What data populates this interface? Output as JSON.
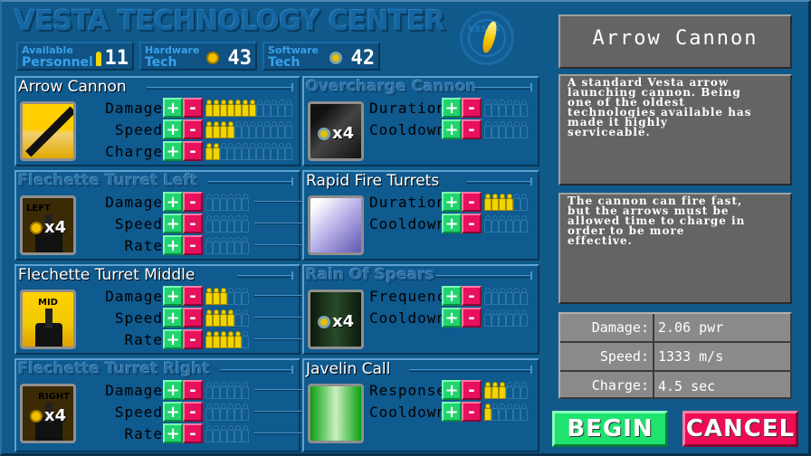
{
  "header": {
    "title": "VESTA TECHNOLOGY CENTER",
    "logo_text": "VESTA",
    "resources": [
      {
        "line1": "Available",
        "line2": "Personnel",
        "icon": "personnel-icon",
        "value": "11"
      },
      {
        "line1": "Hardware",
        "line2": "Tech",
        "icon": "hardware-tech-icon",
        "value": "43"
      },
      {
        "line1": "Software",
        "line2": "Tech",
        "icon": "software-tech-icon",
        "value": "42"
      }
    ]
  },
  "technologies": [
    {
      "name": "Arrow Cannon",
      "locked": false,
      "thumb_label": "",
      "cost": "",
      "stats": [
        {
          "label": "Damage",
          "level": 7,
          "max": 12
        },
        {
          "label": "Speed",
          "level": 4,
          "max": 12
        },
        {
          "label": "Charge",
          "level": 2,
          "max": 12
        }
      ]
    },
    {
      "name": "Overcharge Cannon",
      "locked": true,
      "thumb_label": "",
      "cost": "x4",
      "cost_type": "software",
      "stats": [
        {
          "label": "Duration",
          "level": 0,
          "max": 6
        },
        {
          "label": "Cooldown",
          "level": 0,
          "max": 6
        }
      ]
    },
    {
      "name": "Flechette Turret Left",
      "locked": true,
      "thumb_label": "LEFT",
      "cost": "x4",
      "cost_type": "hardware",
      "stats": [
        {
          "label": "Damage",
          "level": 0,
          "max": 6
        },
        {
          "label": "Speed",
          "level": 0,
          "max": 6
        },
        {
          "label": "Rate",
          "level": 0,
          "max": 6
        }
      ]
    },
    {
      "name": "Rapid Fire Turrets",
      "locked": false,
      "thumb_label": "",
      "cost": "",
      "stats": [
        {
          "label": "Duration",
          "level": 4,
          "max": 6
        },
        {
          "label": "Cooldown",
          "level": 0,
          "max": 6
        }
      ]
    },
    {
      "name": "Flechette Turret Middle",
      "locked": false,
      "thumb_label": "MID",
      "cost": "",
      "stats": [
        {
          "label": "Damage",
          "level": 3,
          "max": 6
        },
        {
          "label": "Speed",
          "level": 4,
          "max": 6
        },
        {
          "label": "Rate",
          "level": 5,
          "max": 6
        }
      ]
    },
    {
      "name": "Rain Of Spears",
      "locked": true,
      "thumb_label": "",
      "cost": "x4",
      "cost_type": "software",
      "stats": [
        {
          "label": "Frequency",
          "level": 0,
          "max": 6
        },
        {
          "label": "Cooldown",
          "level": 0,
          "max": 6
        }
      ]
    },
    {
      "name": "Flechette Turret Right",
      "locked": true,
      "thumb_label": "RIGHT",
      "cost": "x4",
      "cost_type": "hardware",
      "stats": [
        {
          "label": "Damage",
          "level": 0,
          "max": 6
        },
        {
          "label": "Speed",
          "level": 0,
          "max": 6
        },
        {
          "label": "Rate",
          "level": 0,
          "max": 6
        }
      ]
    },
    {
      "name": "Javelin Call",
      "locked": false,
      "thumb_label": "",
      "cost": "",
      "stats": [
        {
          "label": "Response",
          "level": 3,
          "max": 6
        },
        {
          "label": "Cooldown",
          "level": 1,
          "max": 6
        }
      ]
    }
  ],
  "buttons": {
    "plus": "+",
    "minus": "-",
    "begin": "BEGIN",
    "cancel": "CANCEL"
  },
  "detail": {
    "title": "Arrow Cannon",
    "description": "A standard Vesta arrow\nlaunching cannon. Being\none of the oldest\ntechnologies available has\nmade it highly\nserviceable.",
    "tip": "The cannon can fire fast,\nbut the arrows must be\nallowed time to charge in\norder to be more\neffective.",
    "stats": [
      {
        "label": "Damage:",
        "value": "2.06 pwr"
      },
      {
        "label": "Speed:",
        "value": "1333 m/s"
      },
      {
        "label": "Charge:",
        "value": "4.5 sec"
      }
    ]
  },
  "colors": {
    "plus": "#22d46e",
    "minus": "#e8115d",
    "pip_on": "#f2d400",
    "panel": "#0f5a8e"
  }
}
